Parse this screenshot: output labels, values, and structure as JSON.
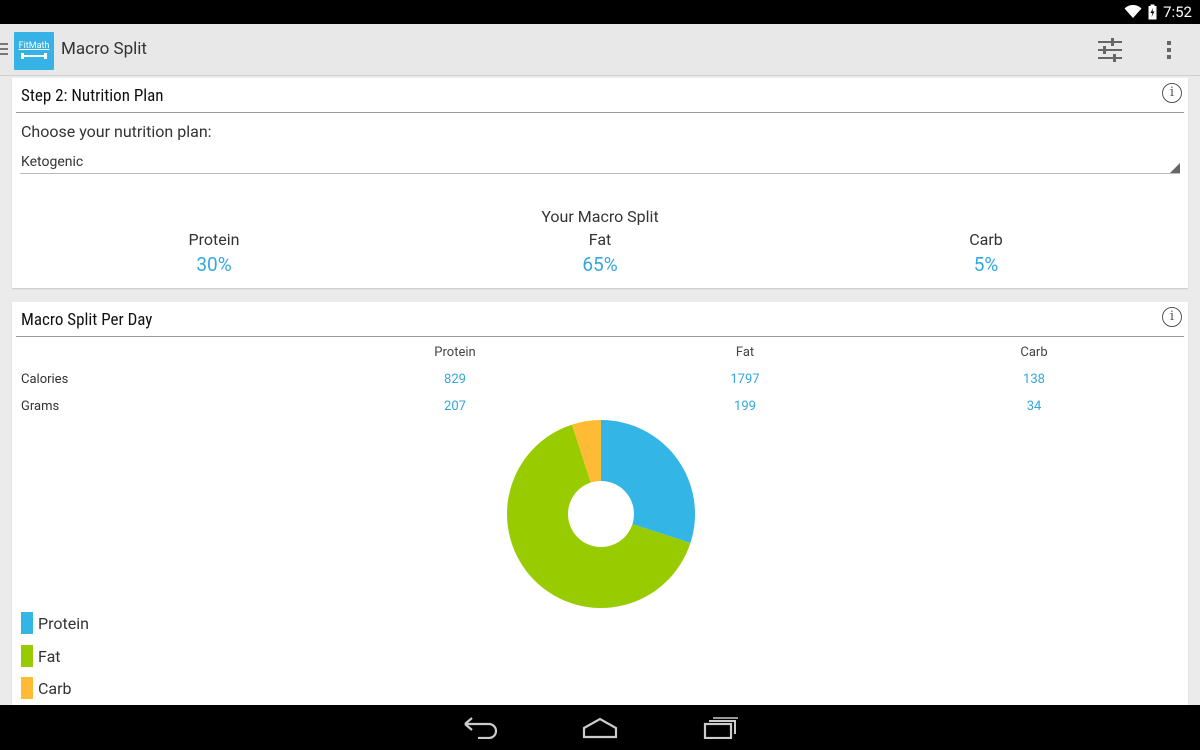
{
  "status_bar": {
    "time": "7:52",
    "battery_level": "charging"
  },
  "action_bar": {
    "logo_text": "FitMath",
    "title": "Macro Split"
  },
  "nutrition_plan": {
    "title": "Step 2: Nutrition Plan",
    "prompt": "Choose your nutrition plan:",
    "selected_plan": "Ketogenic",
    "split_heading": "Your Macro Split",
    "split": [
      {
        "label": "Protein",
        "value": "30%"
      },
      {
        "label": "Fat",
        "value": "65%"
      },
      {
        "label": "Carb",
        "value": "5%"
      }
    ]
  },
  "per_day": {
    "title": "Macro Split Per Day",
    "columns": [
      "Protein",
      "Fat",
      "Carb"
    ],
    "rows": [
      {
        "label": "Calories",
        "values": [
          "829",
          "1797",
          "138"
        ]
      },
      {
        "label": "Grams",
        "values": [
          "207",
          "199",
          "34"
        ]
      }
    ]
  },
  "chart_data": {
    "type": "pie",
    "categories": [
      "Protein",
      "Fat",
      "Carb"
    ],
    "values": [
      829,
      1797,
      138
    ],
    "colors": [
      "#33b5e5",
      "#99cc00",
      "#ffbb33"
    ],
    "legend": "bottom-left",
    "donut": true
  },
  "legend": [
    {
      "label": "Protein",
      "color": "#33b5e5"
    },
    {
      "label": "Fat",
      "color": "#99cc00"
    },
    {
      "label": "Carb",
      "color": "#ffbb33"
    }
  ],
  "icons": {
    "drawer": "drawer-icon",
    "settings": "sliders-icon",
    "overflow": "overflow-menu-icon",
    "info": "info-icon",
    "back": "back-icon",
    "home": "home-icon",
    "recents": "recents-icon"
  },
  "info_glyph": "i"
}
